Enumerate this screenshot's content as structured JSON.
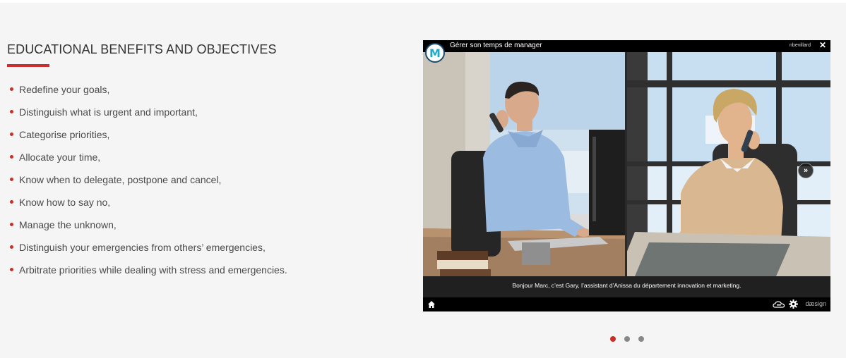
{
  "section": {
    "title": "EDUCATIONAL BENEFITS AND OBJECTIVES",
    "accent_color": "#c9302c",
    "benefits": [
      "Redefine your goals,",
      "Distinguish what is urgent and important,",
      "Categorise priorities,",
      "Allocate your time,",
      "Know when to delegate, postpone and cancel,",
      "Know how to say no,",
      "Manage the unknown,",
      "Distinguish your emergencies from others’ emergencies,",
      "Arbitrate priorities while dealing with stress and emergencies."
    ]
  },
  "player": {
    "title": "Gérer son temps de manager",
    "user": "nbevillard",
    "close_icon": "close-icon",
    "logo_letter": "M",
    "subtitle": "Bonjour Marc, c’est Gary, l’assistant d’Anissa du département innovation et marketing.",
    "next_icon": "»",
    "brand": "dæsign",
    "icons": [
      "home-icon",
      "cloud-icon",
      "gear-icon"
    ]
  },
  "carousel": {
    "slide_count": 3,
    "active_index": 0
  }
}
